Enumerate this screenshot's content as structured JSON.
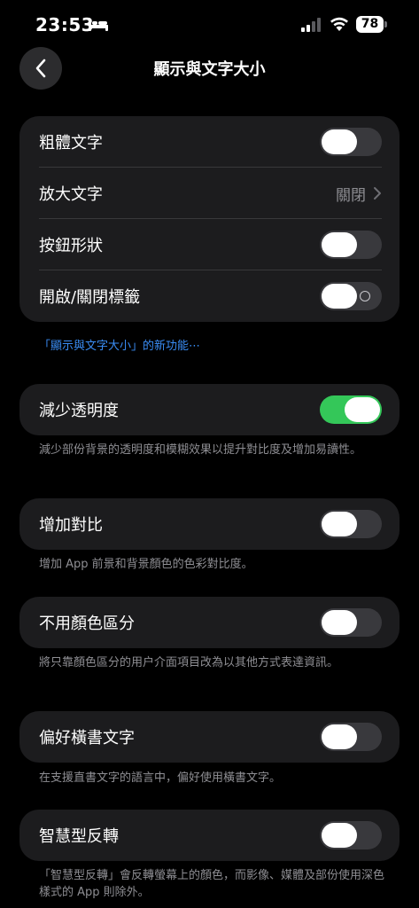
{
  "status_bar": {
    "time": "23:53",
    "battery": "78"
  },
  "nav": {
    "title": "顯示與文字大小"
  },
  "group1": {
    "bold_text": "粗體文字",
    "larger_text": "放大文字",
    "larger_text_value": "關閉",
    "button_shapes": "按鈕形狀",
    "on_off_labels": "開啟/關閉標籤"
  },
  "whats_new_link": "「顯示與文字大小」的新功能⋯",
  "reduce_transparency": {
    "label": "減少透明度",
    "note": "減少部份背景的透明度和模糊效果以提升對比度及增加易讀性。"
  },
  "increase_contrast": {
    "label": "增加對比",
    "note": "增加 App 前景和背景顏色的色彩對比度。"
  },
  "differentiate_without_color": {
    "label": "不用顏色區分",
    "note": "將只靠顏色區分的用户介面項目改為以其他方式表達資訊。"
  },
  "prefer_horizontal_text": {
    "label": "偏好橫書文字",
    "note": "在支援直書文字的語言中，偏好使用橫書文字。"
  },
  "smart_invert": {
    "label": "智慧型反轉",
    "note": "「智慧型反轉」會反轉螢幕上的顏色，而影像、媒體及部份使用深色樣式的 App 則除外。"
  },
  "colors": {
    "accent_green": "#34c759",
    "link_blue": "#3a8df5",
    "group_bg": "#1c1c1e"
  }
}
